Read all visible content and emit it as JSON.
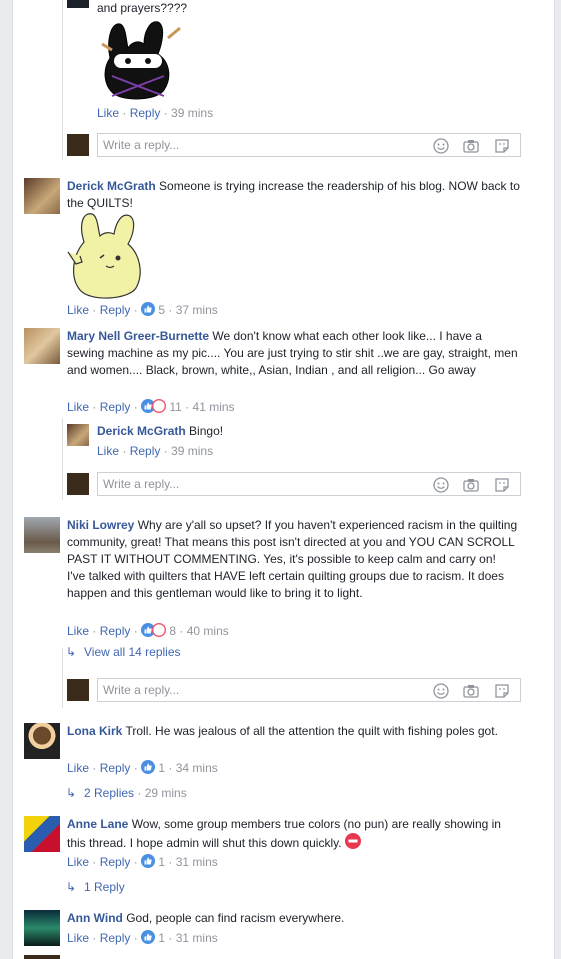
{
  "labels": {
    "like": "Like",
    "reply": "Reply",
    "dot": " · "
  },
  "colors": {
    "link": "#4267b2",
    "author": "#365899",
    "muted": "#90949c",
    "like_blue": "#4a90e2",
    "haha_red": "#f35369"
  },
  "top_reply": {
    "text": "and prayers????",
    "time": "39 mins"
  },
  "reply_box_placeholder": "Write a reply...",
  "reply_box_icons": [
    "smiley-icon",
    "camera-icon",
    "sticker-icon"
  ],
  "comments": [
    {
      "author": "Derick McGrath",
      "text": "Someone is trying increase the readership of his blog. NOW back to the QUILTS!",
      "reactions": "5",
      "time": "37 mins"
    },
    {
      "author": "Mary Nell Greer-Burnette",
      "text": "We don't know what each other look like... I have a sewing machine as my pic.... You are just trying to stir shit ..we are gay, straight, men and women.... Black, brown, white,, Asian, Indian , and all religion... Go away",
      "reactions": "11",
      "time": "41 mins",
      "reply": {
        "author": "Derick McGrath",
        "text": "Bingo!",
        "time": "39 mins"
      }
    },
    {
      "author": "Niki Lowrey",
      "text": "Why are y'all so upset? If you haven't experienced racism in the quilting community, great! That means this post isn't directed at you and YOU CAN SCROLL PAST IT WITHOUT COMMENTING. Yes, it's possible to keep calm and carry on!",
      "text2": "I've talked with quilters that HAVE left certain quilting groups due to racism. It does happen and this gentleman would like to bring it to light.",
      "reactions": "8",
      "time": "40 mins",
      "view_replies": "View all 14 replies"
    },
    {
      "author": "Lona Kirk",
      "text": "Troll. He was jealous of all the attention the quilt with fishing poles got.",
      "reactions": "1",
      "time": "34 mins",
      "replies_label": "2 Replies",
      "replies_time": "29 mins"
    },
    {
      "author": "Anne Lane",
      "text": "Wow, some group members true colors (no pun) are really showing in this thread. I hope admin will shut this down quickly.",
      "reactions": "1",
      "time": "31 mins",
      "replies_label": "1 Reply"
    },
    {
      "author": "Ann Wind",
      "text": "God, people can find racism everywhere.",
      "reactions": "1",
      "time": "31 mins"
    }
  ]
}
